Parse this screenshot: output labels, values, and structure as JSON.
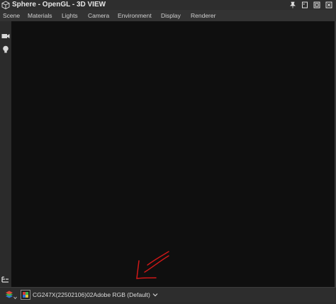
{
  "window": {
    "title": "Sphere - OpenGL - 3D VIEW",
    "buttons": [
      "pin-icon",
      "restore-icon",
      "maximize-icon",
      "close-icon"
    ]
  },
  "menu": {
    "items": [
      "Scene",
      "Materials",
      "Lights",
      "Camera",
      "Environment",
      "Display",
      "Renderer"
    ]
  },
  "toolstrip": {
    "icons": [
      "camera-icon",
      "light-bulb-icon",
      "outline-icon"
    ]
  },
  "status": {
    "color_profile": "CG247X(22502106)02Adobe RGB (Default)"
  },
  "colors": {
    "viewport_bg": "#0f0f0f",
    "annotation_red": "#d01818"
  }
}
